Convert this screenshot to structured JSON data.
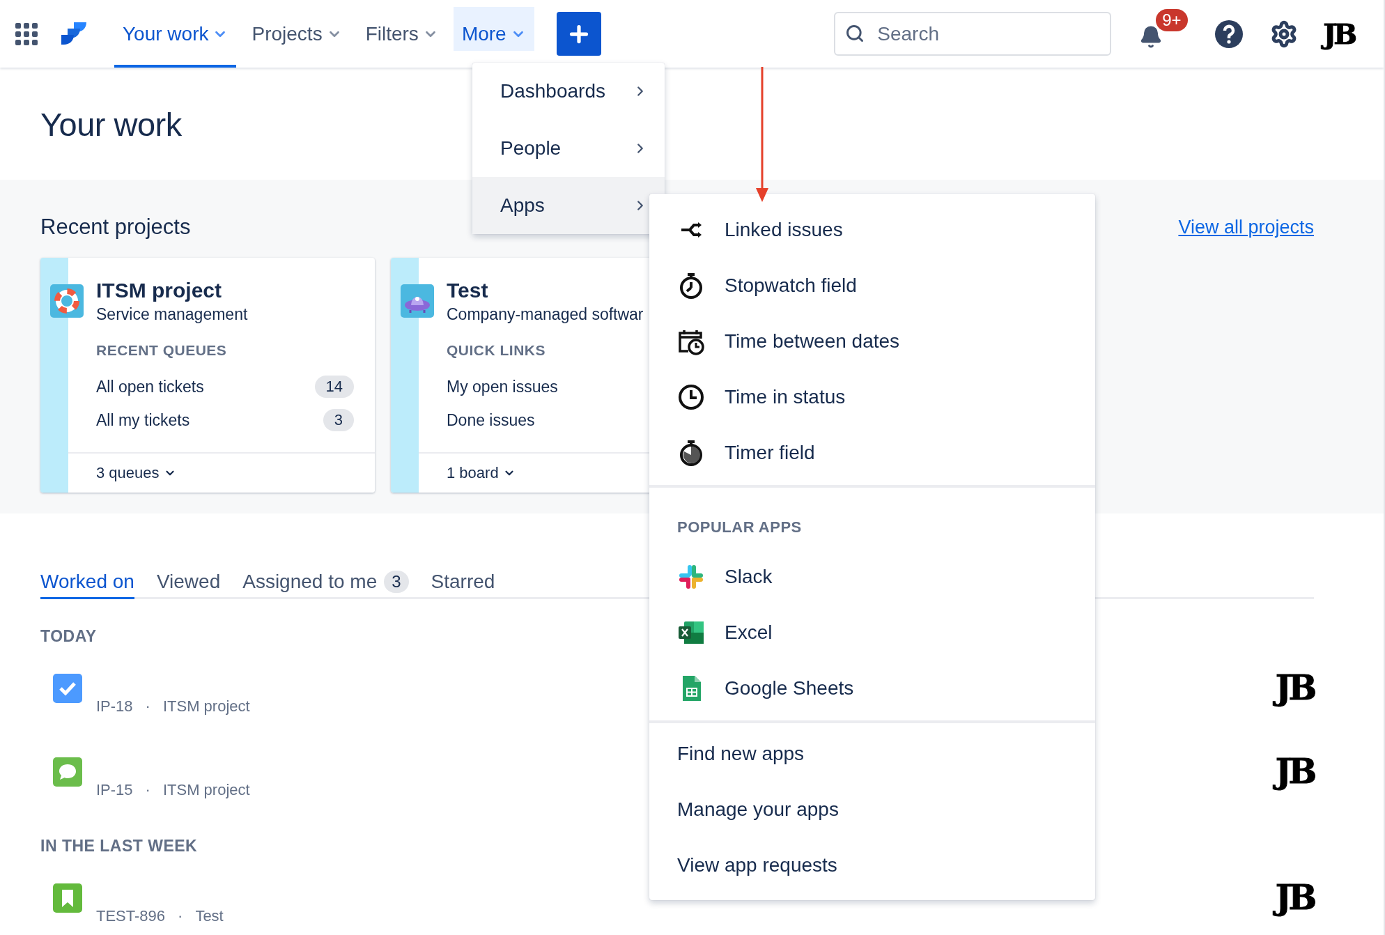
{
  "nav": {
    "items": [
      {
        "label": "Your work",
        "selected": true,
        "open": false
      },
      {
        "label": "Projects",
        "selected": false,
        "open": false
      },
      {
        "label": "Filters",
        "selected": false,
        "open": false
      },
      {
        "label": "More",
        "selected": false,
        "open": true
      }
    ],
    "search": {
      "placeholder": "Search"
    },
    "notifications_badge": "9+",
    "avatar": "JB"
  },
  "more_menu": [
    {
      "label": "Dashboards",
      "selected": false
    },
    {
      "label": "People",
      "selected": false
    },
    {
      "label": "Apps",
      "selected": true
    }
  ],
  "apps_menu": {
    "apps": [
      {
        "label": "Linked issues",
        "kind": "link"
      },
      {
        "label": "Stopwatch field",
        "kind": "stopwatch"
      },
      {
        "label": "Time between dates",
        "kind": "calendar"
      },
      {
        "label": "Time in status",
        "kind": "clock"
      },
      {
        "label": "Timer field",
        "kind": "timer"
      }
    ],
    "popular_title": "POPULAR APPS",
    "popular": [
      {
        "label": "Slack",
        "kind": "slack"
      },
      {
        "label": "Excel",
        "kind": "excel"
      },
      {
        "label": "Google Sheets",
        "kind": "sheets"
      }
    ],
    "links": [
      "Find new apps",
      "Manage your apps",
      "View app requests"
    ]
  },
  "page_title": "Your work",
  "recent_projects": {
    "title": "Recent projects",
    "view_all": "View all projects",
    "cards": [
      {
        "name": "ITSM project",
        "type": "Service management",
        "kind": "service",
        "section": "RECENT QUEUES",
        "links": [
          {
            "label": "All open tickets",
            "count": "14"
          },
          {
            "label": "All my tickets",
            "count": "3"
          }
        ],
        "footer": "3 queues"
      },
      {
        "name": "Test",
        "type": "Company-managed softwar",
        "kind": "software",
        "section": "QUICK LINKS",
        "links": [
          {
            "label": "My open issues"
          },
          {
            "label": "Done issues"
          }
        ],
        "footer": "1 board"
      }
    ]
  },
  "tabs": [
    {
      "label": "Worked on",
      "selected": true
    },
    {
      "label": "Viewed",
      "selected": false
    },
    {
      "label": "Assigned to me",
      "count": "3",
      "selected": false
    },
    {
      "label": "Starred",
      "selected": false
    }
  ],
  "sections": [
    {
      "title": "TODAY",
      "items": [
        {
          "key": "IP-18",
          "separator": "·",
          "project": "ITSM project",
          "kind": "task",
          "avatar": "JB"
        },
        {
          "key": "IP-15",
          "separator": "·",
          "project": "ITSM project",
          "kind": "comment",
          "avatar": "JB"
        }
      ]
    },
    {
      "title": "IN THE LAST WEEK",
      "items": [
        {
          "key": "TEST-896",
          "separator": "·",
          "project": "Test",
          "kind": "story",
          "avatar": "JB"
        }
      ]
    }
  ]
}
